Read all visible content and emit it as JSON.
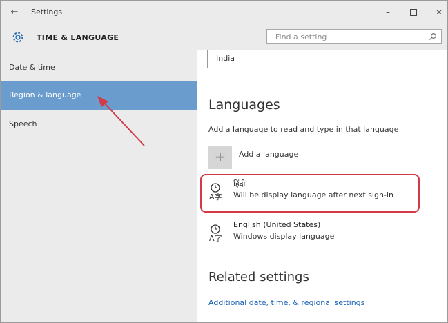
{
  "window": {
    "title": "Settings",
    "controls": {
      "minimize": "–",
      "close": "✕"
    }
  },
  "header": {
    "section_title": "TIME & LANGUAGE",
    "search_placeholder": "Find a setting"
  },
  "sidebar": {
    "items": [
      {
        "label": "Date & time",
        "active": false
      },
      {
        "label": "Region & language",
        "active": true
      },
      {
        "label": "Speech",
        "active": false
      }
    ]
  },
  "content": {
    "country_value": "India",
    "languages_heading": "Languages",
    "languages_description": "Add a language to read and type in that language",
    "add_language_label": "Add a language",
    "languages": [
      {
        "name": "हिंदी",
        "status": "Will be display language after next sign-in",
        "highlighted": true
      },
      {
        "name": "English (United States)",
        "status": "Windows display language",
        "highlighted": false
      }
    ],
    "related_heading": "Related settings",
    "related_link": "Additional date, time, & regional settings"
  },
  "colors": {
    "sidebar_bg": "#ebebeb",
    "active_item": "#6a9ccd",
    "link": "#1a63b7",
    "annotation": "#d33a48"
  }
}
